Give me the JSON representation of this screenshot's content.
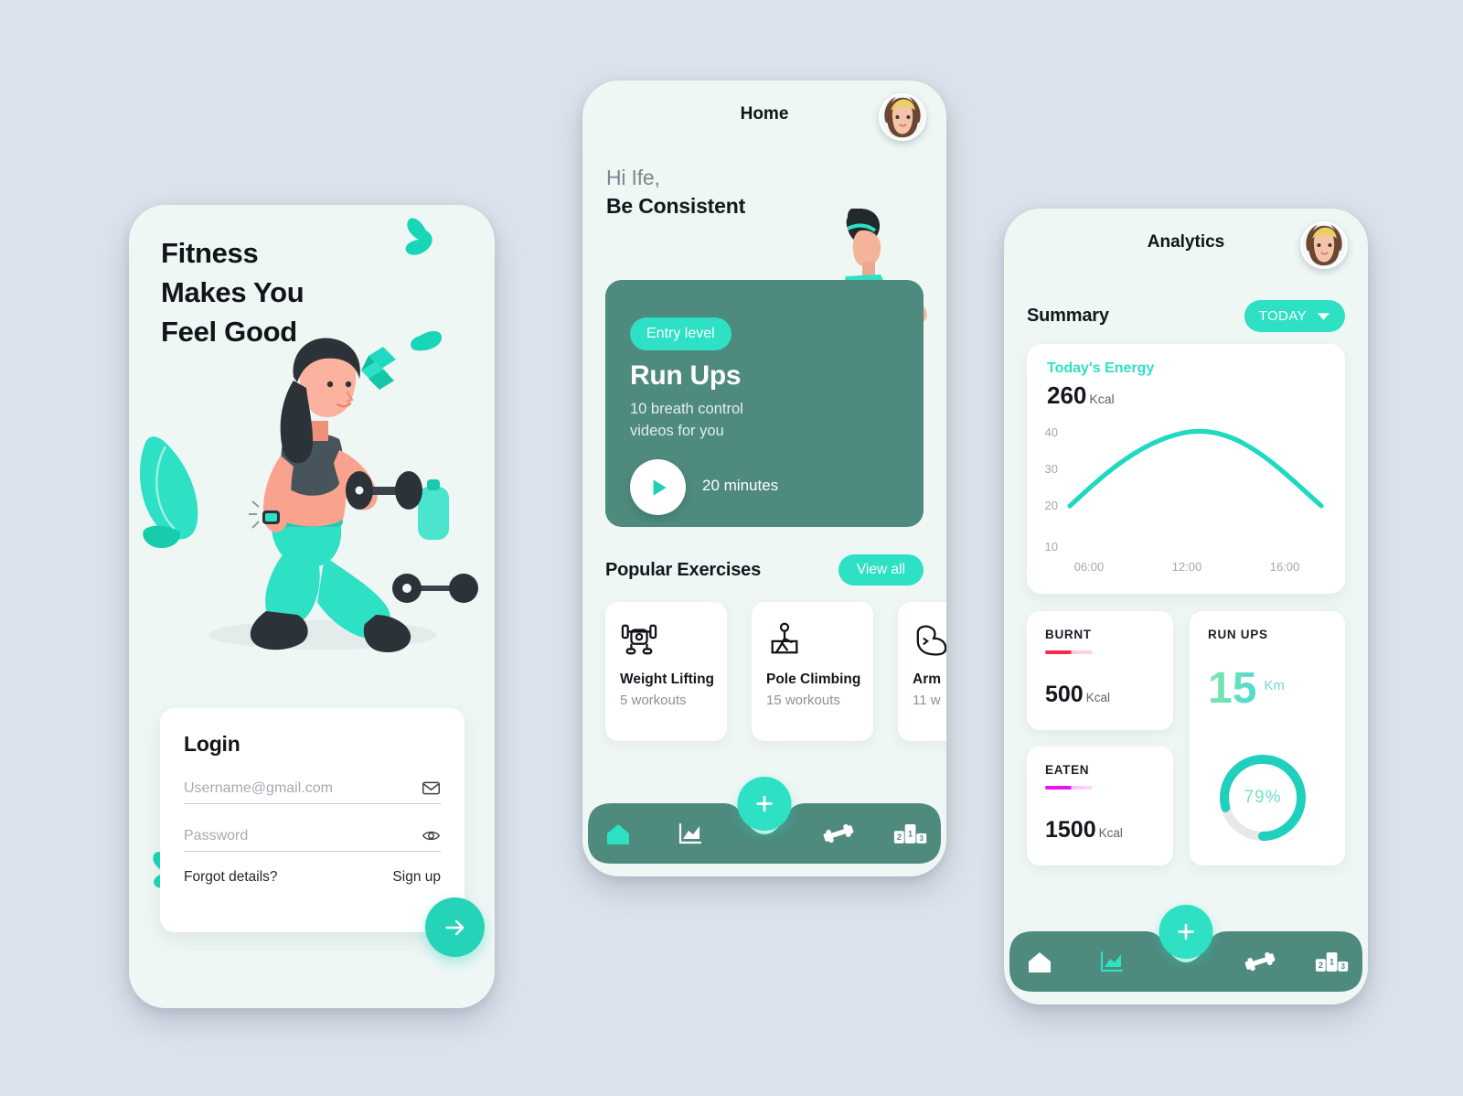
{
  "canvas": {
    "background": "#dde3ec"
  },
  "theme": {
    "accent_teal": "#2ee0c4",
    "card_dark_teal": "#4e8a7e",
    "nav_dark_teal": "#4e8a7e",
    "screen_bg": "#eff7f5",
    "burnt_bar": "#f8294f",
    "eaten_bar": "#e815e8"
  },
  "login_screen": {
    "hero_title": "Fitness\nMakes You\nFeel Good",
    "card_title": "Login",
    "username": {
      "value": "",
      "placeholder": "Username@gmail.com",
      "icon": "envelope-icon"
    },
    "password": {
      "value": "",
      "placeholder": "Password",
      "icon": "eye-icon"
    },
    "forgot_label": "Forgot details?",
    "signup_label": "Sign up",
    "submit_icon": "arrow-right-icon"
  },
  "home_screen": {
    "title": "Home",
    "avatar": "user-avatar",
    "greeting_line1": "Hi Ife,",
    "greeting_line2": "Be Consistent",
    "promo": {
      "badge": "Entry level",
      "title": "Run Ups",
      "description": "10 breath control\nvideos for you",
      "duration": "20 minutes",
      "play_icon": "play-icon"
    },
    "section_title": "Popular Exercises",
    "view_all_label": "View all",
    "exercises": [
      {
        "name": "Weight Lifting",
        "count": "5 workouts",
        "icon": "bench-press-icon"
      },
      {
        "name": "Pole Climbing",
        "count": "15 workouts",
        "icon": "pole-climb-icon"
      },
      {
        "name": "Arm",
        "count": "11 w",
        "icon": "bicep-icon"
      }
    ],
    "nav": {
      "fab_icon": "plus-icon",
      "items": [
        {
          "icon": "home-icon",
          "active": true
        },
        {
          "icon": "chart-icon",
          "active": false
        },
        {
          "icon": "dumbbell-icon",
          "active": false
        },
        {
          "icon": "podium-icon",
          "active": false
        }
      ]
    }
  },
  "analytics_screen": {
    "title": "Analytics",
    "avatar": "user-avatar",
    "summary_label": "Summary",
    "period_label": "TODAY",
    "period_icon": "chevron-down-icon",
    "energy_card": {
      "label": "Today's Energy",
      "value": "260",
      "unit": "Kcal"
    },
    "stats": [
      {
        "label": "BURNT",
        "value": "500",
        "unit": "Kcal",
        "bar_color": "#f8294f"
      },
      {
        "label": "EATEN",
        "value": "1500",
        "unit": "Kcal",
        "bar_color": "#e815e8"
      }
    ],
    "run_ups": {
      "label": "RUN UPS",
      "value": "15",
      "unit": "Km",
      "progress_value": "79%",
      "progress_pct": 79
    },
    "nav": {
      "fab_icon": "plus-icon",
      "items": [
        {
          "icon": "home-icon",
          "active": false
        },
        {
          "icon": "chart-icon",
          "active": true
        },
        {
          "icon": "dumbbell-icon",
          "active": false
        },
        {
          "icon": "podium-icon",
          "active": false
        }
      ]
    }
  },
  "chart_data": {
    "type": "line",
    "title": "Today's Energy",
    "xlabel": "",
    "ylabel": "",
    "x_ticks": [
      "06:00",
      "12:00",
      "16:00"
    ],
    "y_ticks": [
      40,
      30,
      20,
      10
    ],
    "ylim": [
      10,
      45
    ],
    "grid": false,
    "legend": "none",
    "line_color": "#1fd9c0",
    "series": [
      {
        "name": "Energy",
        "x": [
          "06:00",
          "07:30",
          "09:00",
          "10:30",
          "12:00",
          "13:30",
          "15:00",
          "16:00",
          "17:30"
        ],
        "values": [
          20,
          26,
          32,
          37,
          40,
          39,
          34,
          27,
          20
        ]
      }
    ],
    "annotations": [
      {
        "text": "260 Kcal",
        "type": "headline-value"
      }
    ]
  }
}
